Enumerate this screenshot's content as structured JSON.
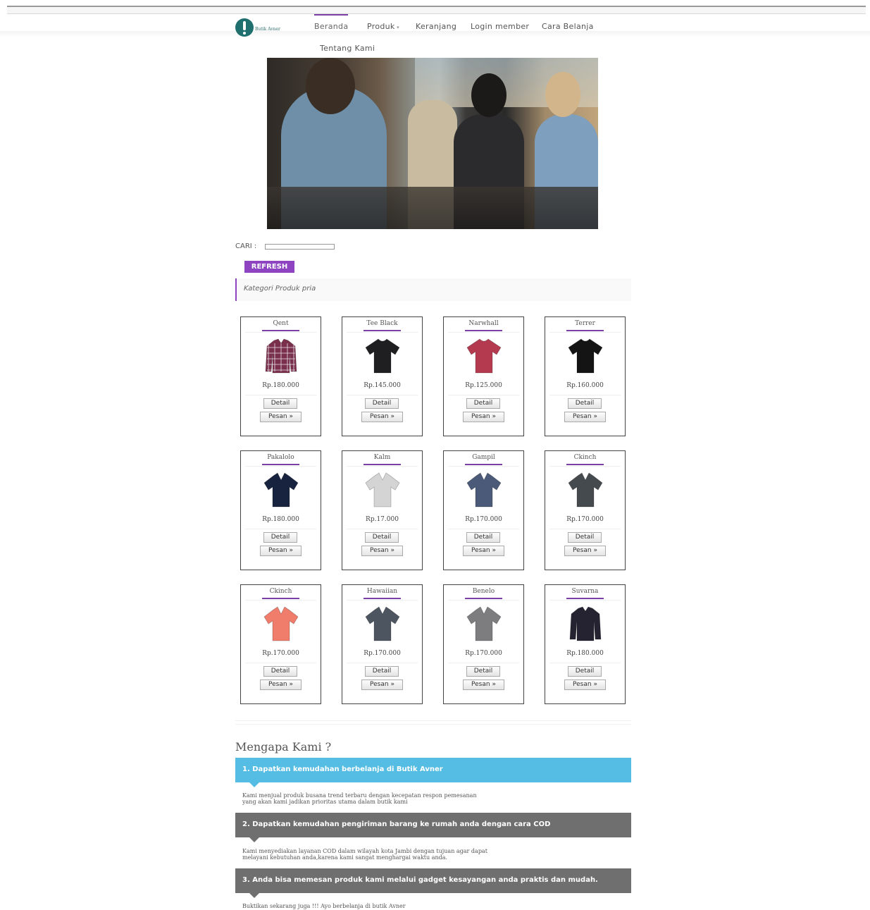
{
  "logo": {
    "text": "Butik Avner"
  },
  "nav": {
    "items": [
      {
        "label": "Beranda",
        "active": true
      },
      {
        "label": "Produk"
      },
      {
        "label": "Keranjang"
      },
      {
        "label": "Login member"
      },
      {
        "label": "Cara Belanja"
      },
      {
        "label": "Tentang Kami"
      }
    ]
  },
  "search": {
    "label": "CARI :",
    "value": ""
  },
  "refresh_label": "REFRESH",
  "category_title": "Kategori Produk pria",
  "buttons": {
    "detail": "Detail",
    "pesan": "Pesan »"
  },
  "products": [
    {
      "name": "Qent",
      "price": "Rp.180.000",
      "color": "#7a2f4a",
      "icon": "flannel-shirt-icon"
    },
    {
      "name": "Tee Black",
      "price": "Rp.145.000",
      "color": "#1f1f22",
      "icon": "tshirt-icon"
    },
    {
      "name": "Narwhall",
      "price": "Rp.125.000",
      "color": "#b33a4f",
      "icon": "tshirt-icon"
    },
    {
      "name": "Terrer",
      "price": "Rp.160.000",
      "color": "#141414",
      "icon": "tshirt-icon"
    },
    {
      "name": "Pakalolo",
      "price": "Rp.180.000",
      "color": "#18243f",
      "icon": "polo-shirt-icon"
    },
    {
      "name": "Kalm",
      "price": "Rp.17.000",
      "color": "#d4d4d4",
      "icon": "polo-shirt-icon"
    },
    {
      "name": "Gampil",
      "price": "Rp.170.000",
      "color": "#4a5a78",
      "icon": "polo-shirt-icon"
    },
    {
      "name": "Ckinch",
      "price": "Rp.170.000",
      "color": "#454a4e",
      "icon": "polo-shirt-icon"
    },
    {
      "name": "Ckinch",
      "price": "Rp.170.000",
      "color": "#f07c6c",
      "icon": "polo-shirt-icon"
    },
    {
      "name": "Hawaiian",
      "price": "Rp.170.000",
      "color": "#4d5560",
      "icon": "polo-shirt-icon"
    },
    {
      "name": "Benelo",
      "price": "Rp.170.000",
      "color": "#7d7d80",
      "icon": "polo-shirt-icon"
    },
    {
      "name": "Suvarna",
      "price": "Rp.180.000",
      "color": "#252231",
      "icon": "long-sleeve-shirt-icon"
    }
  ],
  "why": {
    "title": "Mengapa Kami ?",
    "sections": [
      {
        "heading": "1. Dapatkan kemudahan berbelanja di Butik Avner",
        "text_lines": [
          "Kami menjual produk busana trend terbaru dengan kecepatan respon pemesanan",
          "yang akan kami jadikan prioritas utama dalam butik kami"
        ]
      },
      {
        "heading": "2. Dapatkan kemudahan pengiriman barang ke rumah anda dengan cara COD",
        "text_lines": [
          "Kami menyediakan layanan COD dalam wilayah kota Jambi dengan tujuan agar dapat",
          "melayani kebutuhan anda,karena kami sangat menghargai waktu anda."
        ]
      },
      {
        "heading": "3. Anda bisa memesan produk kami melalui gadget kesayangan anda praktis dan mudah.",
        "text_lines": [
          "Buktikan sekarang juga !!! Ayo berbelanja di butik Avner"
        ]
      }
    ]
  },
  "colors": {
    "accent": "#8e44c0",
    "nav_active": "#7b3fa6",
    "info_blue": "#55bde3",
    "info_grey": "#6f6f6f"
  }
}
